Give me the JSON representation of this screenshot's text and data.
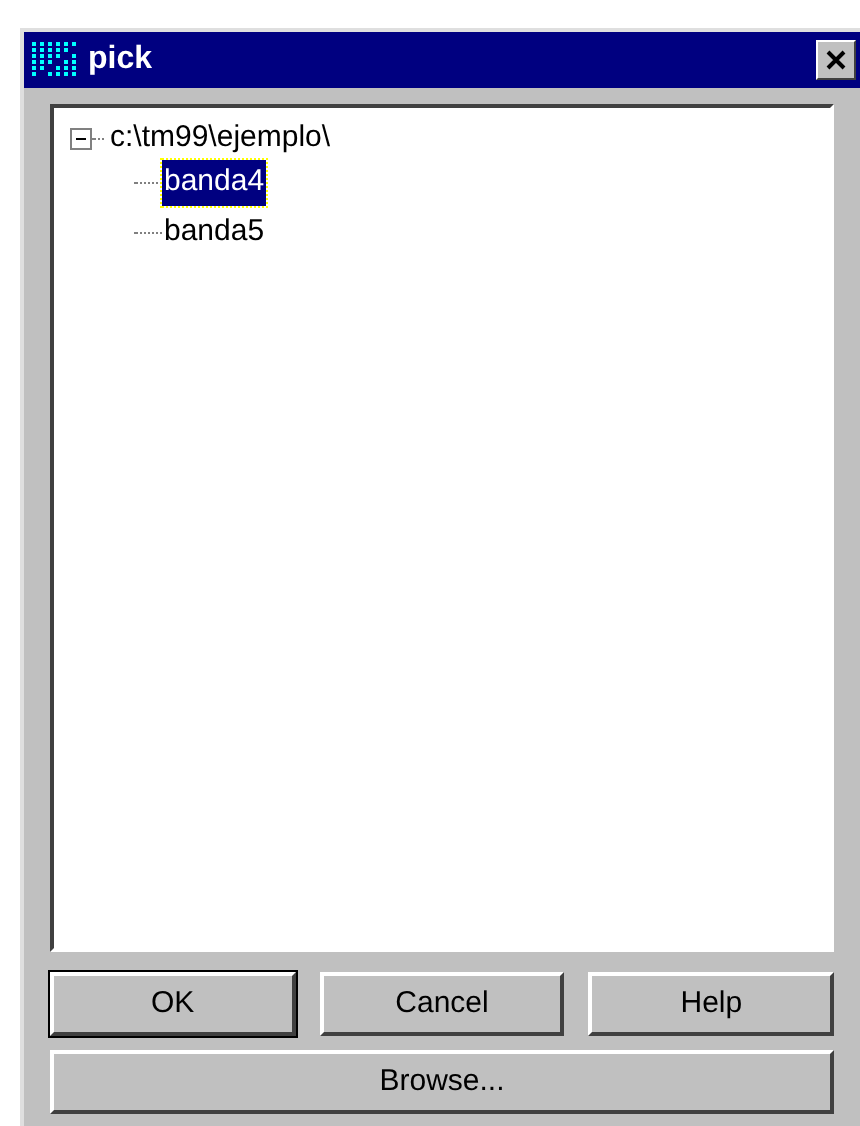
{
  "window": {
    "title": "pick"
  },
  "tree": {
    "label": "c:\\tm99\\ejemplo\\",
    "expanded": true,
    "children": [
      {
        "label": "banda4",
        "selected": true
      },
      {
        "label": "banda5",
        "selected": false
      }
    ]
  },
  "buttons": [
    "OK",
    "Cancel",
    "Help"
  ],
  "browse_button": "Browse..."
}
